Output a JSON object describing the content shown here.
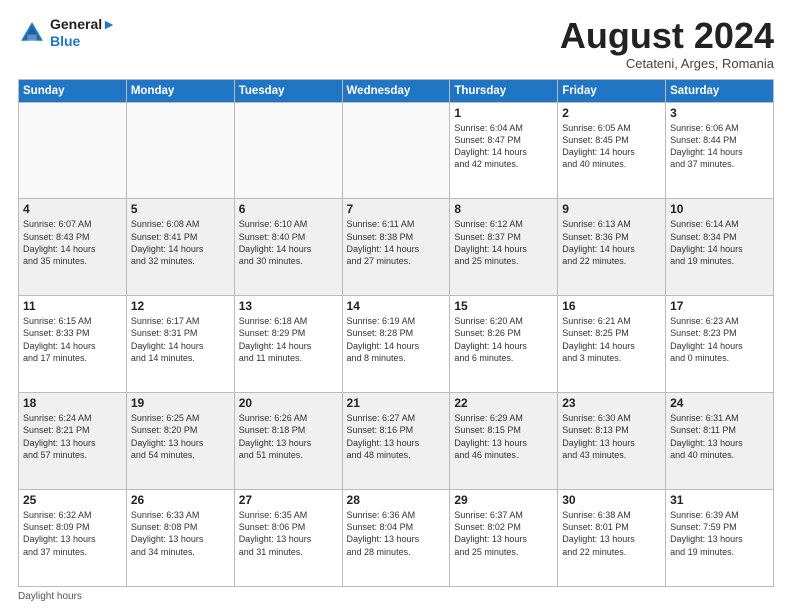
{
  "header": {
    "logo_line1": "General",
    "logo_line2": "Blue",
    "month": "August 2024",
    "location": "Cetateni, Arges, Romania"
  },
  "days_of_week": [
    "Sunday",
    "Monday",
    "Tuesday",
    "Wednesday",
    "Thursday",
    "Friday",
    "Saturday"
  ],
  "weeks": [
    [
      {
        "day": "",
        "text": ""
      },
      {
        "day": "",
        "text": ""
      },
      {
        "day": "",
        "text": ""
      },
      {
        "day": "",
        "text": ""
      },
      {
        "day": "1",
        "text": "Sunrise: 6:04 AM\nSunset: 8:47 PM\nDaylight: 14 hours\nand 42 minutes."
      },
      {
        "day": "2",
        "text": "Sunrise: 6:05 AM\nSunset: 8:45 PM\nDaylight: 14 hours\nand 40 minutes."
      },
      {
        "day": "3",
        "text": "Sunrise: 6:06 AM\nSunset: 8:44 PM\nDaylight: 14 hours\nand 37 minutes."
      }
    ],
    [
      {
        "day": "4",
        "text": "Sunrise: 6:07 AM\nSunset: 8:43 PM\nDaylight: 14 hours\nand 35 minutes."
      },
      {
        "day": "5",
        "text": "Sunrise: 6:08 AM\nSunset: 8:41 PM\nDaylight: 14 hours\nand 32 minutes."
      },
      {
        "day": "6",
        "text": "Sunrise: 6:10 AM\nSunset: 8:40 PM\nDaylight: 14 hours\nand 30 minutes."
      },
      {
        "day": "7",
        "text": "Sunrise: 6:11 AM\nSunset: 8:38 PM\nDaylight: 14 hours\nand 27 minutes."
      },
      {
        "day": "8",
        "text": "Sunrise: 6:12 AM\nSunset: 8:37 PM\nDaylight: 14 hours\nand 25 minutes."
      },
      {
        "day": "9",
        "text": "Sunrise: 6:13 AM\nSunset: 8:36 PM\nDaylight: 14 hours\nand 22 minutes."
      },
      {
        "day": "10",
        "text": "Sunrise: 6:14 AM\nSunset: 8:34 PM\nDaylight: 14 hours\nand 19 minutes."
      }
    ],
    [
      {
        "day": "11",
        "text": "Sunrise: 6:15 AM\nSunset: 8:33 PM\nDaylight: 14 hours\nand 17 minutes."
      },
      {
        "day": "12",
        "text": "Sunrise: 6:17 AM\nSunset: 8:31 PM\nDaylight: 14 hours\nand 14 minutes."
      },
      {
        "day": "13",
        "text": "Sunrise: 6:18 AM\nSunset: 8:29 PM\nDaylight: 14 hours\nand 11 minutes."
      },
      {
        "day": "14",
        "text": "Sunrise: 6:19 AM\nSunset: 8:28 PM\nDaylight: 14 hours\nand 8 minutes."
      },
      {
        "day": "15",
        "text": "Sunrise: 6:20 AM\nSunset: 8:26 PM\nDaylight: 14 hours\nand 6 minutes."
      },
      {
        "day": "16",
        "text": "Sunrise: 6:21 AM\nSunset: 8:25 PM\nDaylight: 14 hours\nand 3 minutes."
      },
      {
        "day": "17",
        "text": "Sunrise: 6:23 AM\nSunset: 8:23 PM\nDaylight: 14 hours\nand 0 minutes."
      }
    ],
    [
      {
        "day": "18",
        "text": "Sunrise: 6:24 AM\nSunset: 8:21 PM\nDaylight: 13 hours\nand 57 minutes."
      },
      {
        "day": "19",
        "text": "Sunrise: 6:25 AM\nSunset: 8:20 PM\nDaylight: 13 hours\nand 54 minutes."
      },
      {
        "day": "20",
        "text": "Sunrise: 6:26 AM\nSunset: 8:18 PM\nDaylight: 13 hours\nand 51 minutes."
      },
      {
        "day": "21",
        "text": "Sunrise: 6:27 AM\nSunset: 8:16 PM\nDaylight: 13 hours\nand 48 minutes."
      },
      {
        "day": "22",
        "text": "Sunrise: 6:29 AM\nSunset: 8:15 PM\nDaylight: 13 hours\nand 46 minutes."
      },
      {
        "day": "23",
        "text": "Sunrise: 6:30 AM\nSunset: 8:13 PM\nDaylight: 13 hours\nand 43 minutes."
      },
      {
        "day": "24",
        "text": "Sunrise: 6:31 AM\nSunset: 8:11 PM\nDaylight: 13 hours\nand 40 minutes."
      }
    ],
    [
      {
        "day": "25",
        "text": "Sunrise: 6:32 AM\nSunset: 8:09 PM\nDaylight: 13 hours\nand 37 minutes."
      },
      {
        "day": "26",
        "text": "Sunrise: 6:33 AM\nSunset: 8:08 PM\nDaylight: 13 hours\nand 34 minutes."
      },
      {
        "day": "27",
        "text": "Sunrise: 6:35 AM\nSunset: 8:06 PM\nDaylight: 13 hours\nand 31 minutes."
      },
      {
        "day": "28",
        "text": "Sunrise: 6:36 AM\nSunset: 8:04 PM\nDaylight: 13 hours\nand 28 minutes."
      },
      {
        "day": "29",
        "text": "Sunrise: 6:37 AM\nSunset: 8:02 PM\nDaylight: 13 hours\nand 25 minutes."
      },
      {
        "day": "30",
        "text": "Sunrise: 6:38 AM\nSunset: 8:01 PM\nDaylight: 13 hours\nand 22 minutes."
      },
      {
        "day": "31",
        "text": "Sunrise: 6:39 AM\nSunset: 7:59 PM\nDaylight: 13 hours\nand 19 minutes."
      }
    ]
  ],
  "footer": {
    "note": "Daylight hours"
  }
}
